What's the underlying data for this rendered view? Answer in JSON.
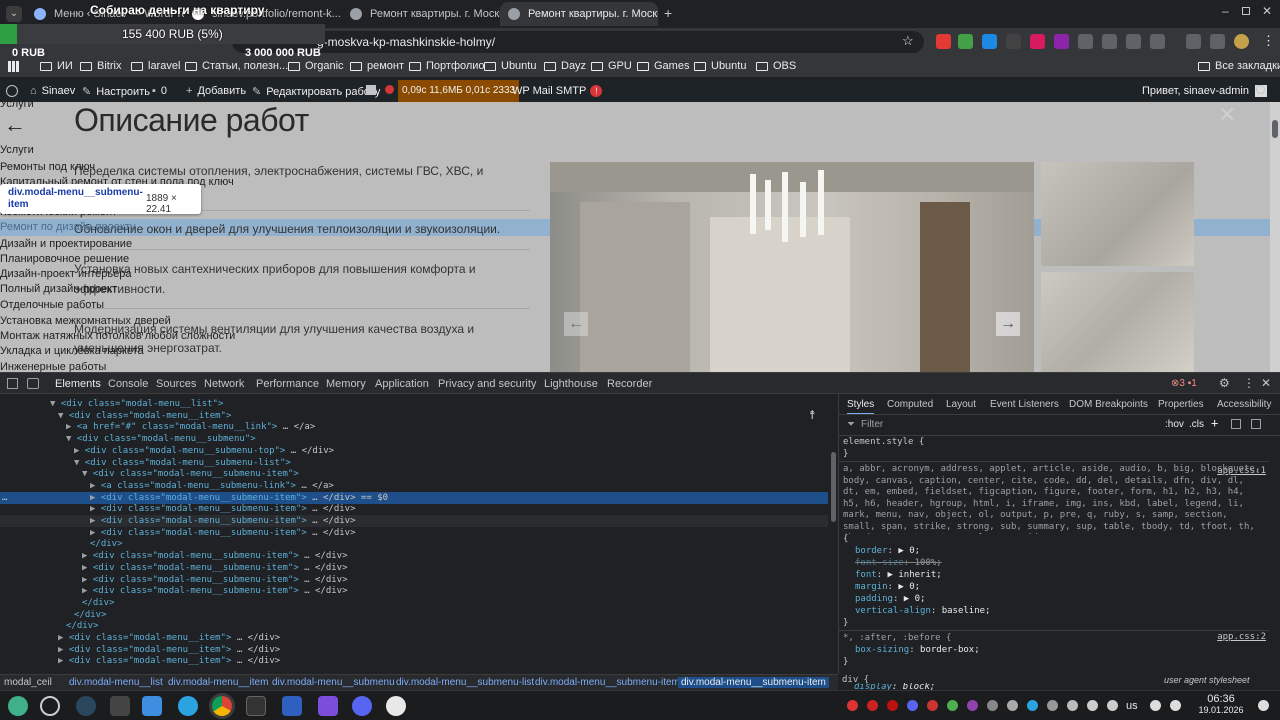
{
  "donation": {
    "title": "Собираю деньги на квартиру",
    "current": "155 400 RUB (5%)",
    "min": "0 RUB",
    "max": "3 000 000 RUB",
    "progress_percent": 5.18
  },
  "tabs": [
    {
      "label": "Меню ‹ Sinaev — WordPress",
      "active": false
    },
    {
      "label": "sinaev.portfolio/remont-k...",
      "active": false
    },
    {
      "label": "Ремонт квартиры. г. Москв",
      "active": false
    },
    {
      "label": "Ремонт квартиры. г. Москв",
      "active": true
    }
  ],
  "omnibox": {
    "url": "g-moskva-kp-mashkinskie-holmy/"
  },
  "bookmarks": [
    "ИИ",
    "Bitrix",
    "laravel",
    "Статьи, полезн...",
    "Organic",
    "ремонт",
    "Портфолио",
    "Ubuntu",
    "Dayz",
    "GPU",
    "Games",
    "Ubuntu",
    "OBS"
  ],
  "bookmarks_all": "Все закладки",
  "wpbar": {
    "site": "Sinaev",
    "customize": "Настроить",
    "comments": "0",
    "add": "Добавить",
    "edit": "Редактировать работу",
    "perf": "0,09с 11,6МБ 0,01с 2333",
    "smtp": "WP Mail SMTP",
    "smtp_badge": "!",
    "greeting": "Привет, sinaev-admin"
  },
  "page": {
    "heading": "Описание работ",
    "items": [
      "Переделка системы отопления, электроснабжения, системы ГВС, ХВС, и",
      "Обновление окон и дверей для улучшения теплоизоляции и звукоизоляции.",
      "Установка новых сантехнических приборов для повышения комфорта и",
      "эффективности.",
      "Модернизация системы вентиляции для улучшения качества воздуха и",
      "уменьшения энергозатрат."
    ],
    "menu_overlay": [
      "Услуги",
      "Услуги",
      "Ремонты под ключ",
      "Капитальный ремонт от стен и пола под ключ",
      "Косметический ремонт",
      "Ремонт по дизайн-проекту",
      "Дизайн и проектирование",
      "Планировочное решение",
      "Дизайн-проект интерьера",
      "Полный дизайн-проект",
      "Отделочные работы",
      "Установка межкомнатных дверей",
      "Монтаж натяжных потолков любой сложности",
      "Укладка и циклевка паркета",
      "Инженерные работы"
    ],
    "back_arrow": "←",
    "close": "✕",
    "prev": "←",
    "next": "→"
  },
  "tooltip": {
    "selector": "div.modal-menu__submenu-item",
    "size": "1889 × 22.41"
  },
  "devtools": {
    "tabs": [
      "Elements",
      "Console",
      "Sources",
      "Network",
      "Performance",
      "Memory",
      "Application",
      "Privacy and security",
      "Lighthouse",
      "Recorder"
    ],
    "errors": "3",
    "issues": "1",
    "dom": [
      {
        "ind": 50,
        "t": "▼",
        "open": "<div class=\"modal-menu__list\">",
        "tail": ""
      },
      {
        "ind": 58,
        "t": "▼",
        "open": "<div class=\"modal-menu__item\">",
        "tail": ""
      },
      {
        "ind": 66,
        "t": "▶",
        "open": "<a href=\"#\" class=\"modal-menu__link\">",
        "tail": "… </a>"
      },
      {
        "ind": 66,
        "t": "▼",
        "open": "<div class=\"modal-menu__submenu\">",
        "tail": ""
      },
      {
        "ind": 74,
        "t": "▶",
        "open": "<div class=\"modal-menu__submenu-top\">",
        "tail": "… </div>"
      },
      {
        "ind": 74,
        "t": "▼",
        "open": "<div class=\"modal-menu__submenu-list\">",
        "tail": ""
      },
      {
        "ind": 82,
        "t": "▼",
        "open": "<div class=\"modal-menu__submenu-item\">",
        "tail": ""
      },
      {
        "ind": 90,
        "t": "▶",
        "open": "<a class=\"modal-menu__submenu-link\">",
        "tail": "… </a>"
      },
      {
        "ind": 90,
        "t": "▶",
        "open": "<div class=\"modal-menu__submenu-item\">",
        "tail": "… </div> == $0",
        "sel": true
      },
      {
        "ind": 90,
        "t": "▶",
        "open": "<div class=\"modal-menu__submenu-item\">",
        "tail": "… </div>"
      },
      {
        "ind": 90,
        "t": "▶",
        "open": "<div class=\"modal-menu__submenu-item\">",
        "tail": "… </div>",
        "hov": true
      },
      {
        "ind": 90,
        "t": "▶",
        "open": "<div class=\"modal-menu__submenu-item\">",
        "tail": "… </div>"
      },
      {
        "ind": 90,
        "t": "",
        "open": "</div>",
        "tail": ""
      },
      {
        "ind": 82,
        "t": "▶",
        "open": "<div class=\"modal-menu__submenu-item\">",
        "tail": "… </div>"
      },
      {
        "ind": 82,
        "t": "▶",
        "open": "<div class=\"modal-menu__submenu-item\">",
        "tail": "… </div>"
      },
      {
        "ind": 82,
        "t": "▶",
        "open": "<div class=\"modal-menu__submenu-item\">",
        "tail": "… </div>"
      },
      {
        "ind": 82,
        "t": "▶",
        "open": "<div class=\"modal-menu__submenu-item\">",
        "tail": "… </div>"
      },
      {
        "ind": 82,
        "t": "",
        "open": "</div>",
        "tail": ""
      },
      {
        "ind": 74,
        "t": "",
        "open": "</div>",
        "tail": ""
      },
      {
        "ind": 66,
        "t": "",
        "open": "</div>",
        "tail": ""
      },
      {
        "ind": 58,
        "t": "▶",
        "open": "<div class=\"modal-menu__item\">",
        "tail": "… </div>"
      },
      {
        "ind": 58,
        "t": "▶",
        "open": "<div class=\"modal-menu__item\">",
        "tail": "… </div>"
      },
      {
        "ind": 58,
        "t": "▶",
        "open": "<div class=\"modal-menu__item\">",
        "tail": "… </div>"
      }
    ],
    "style_tabs": [
      "Styles",
      "Computed",
      "Layout",
      "Event Listeners",
      "DOM Breakpoints",
      "Properties",
      "Accessibility"
    ],
    "filter_placeholder": "Filter",
    "hov": ":hov",
    "cls": ".cls",
    "styles": {
      "element_style": "element.style {",
      "close": "}",
      "reset_selector": "a, abbr, acronym, address, applet, article, aside, audio, b, big, blockquote, body, canvas, caption, center, cite, code, dd, del, details, dfn, div, dl, dt, em, embed, fieldset, figcaption, figure, footer, form, h1, h2, h3, h4, h5, h6, header, hgroup, html, i, iframe, img, ins, kbd, label, legend, li, mark, menu, nav, object, ol, output, p, pre, q, ruby, s, samp, section, small, span, strike, strong, sub, summary, sup, table, tbody, td, tfoot, th, thead, time, tr, tt, u, ul, var, video",
      "src1": "app.css:1",
      "props": [
        [
          "border",
          "▶ 0;"
        ],
        [
          "font-size",
          "100%;"
        ],
        [
          "font",
          "▶ inherit;"
        ],
        [
          "margin",
          "▶ 0;"
        ],
        [
          "padding",
          "▶ 0;"
        ],
        [
          "vertical-align",
          "baseline;"
        ]
      ],
      "sel2": "*, :after, :before {",
      "src2": "app.css:2",
      "prop2": [
        "box-sizing",
        "border-box;"
      ],
      "div_sel": "div {",
      "ua": "user agent stylesheet",
      "div_prop": [
        "display",
        "block;"
      ]
    },
    "breadcrumbs": [
      "modal_ceil",
      "div.modal-menu__list",
      "div.modal-menu__item",
      "div.modal-menu__submenu",
      "div.modal-menu__submenu-list",
      "div.modal-menu__submenu-item",
      "div.modal-menu__submenu-item"
    ]
  },
  "taskbar": {
    "clock": "06:36",
    "date": "19.01.2026",
    "lang": "us"
  }
}
